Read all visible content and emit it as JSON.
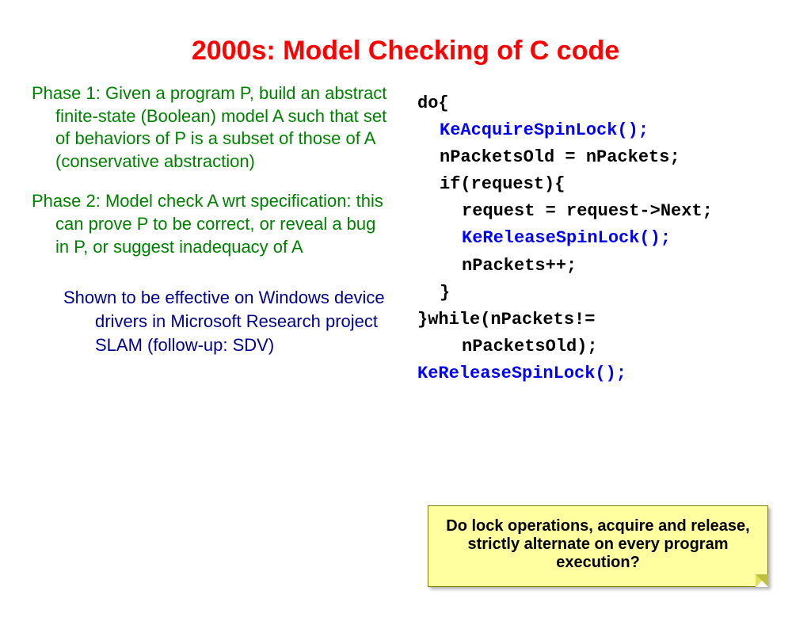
{
  "title": "2000s: Model Checking of C code",
  "left": {
    "phase1": "Phase 1: Given a program P, build an abstract finite-state (Boolean) model A such that set of behaviors of P is a subset of those of A (conservative abstraction)",
    "phase2": "Phase 2: Model check A wrt specification: this can prove P to be correct, or reveal a bug in P, or suggest inadequacy of A",
    "slam": "Shown to be effective on Windows device drivers in Microsoft Research project SLAM (follow-up: SDV)"
  },
  "code": {
    "l1": "do{",
    "l2": "KeAcquireSpinLock();",
    "l3": "nPacketsOld = nPackets;",
    "l4": "if(request){",
    "l5": "request = request->Next;",
    "l6": "KeReleaseSpinLock();",
    "l7": "nPackets++;",
    "l8": "}",
    "l9a": "}while(nPackets!=",
    "l9b": "nPacketsOld);",
    "l10": "KeReleaseSpinLock();"
  },
  "callout": "Do lock operations, acquire and release,  strictly alternate on every program execution?"
}
